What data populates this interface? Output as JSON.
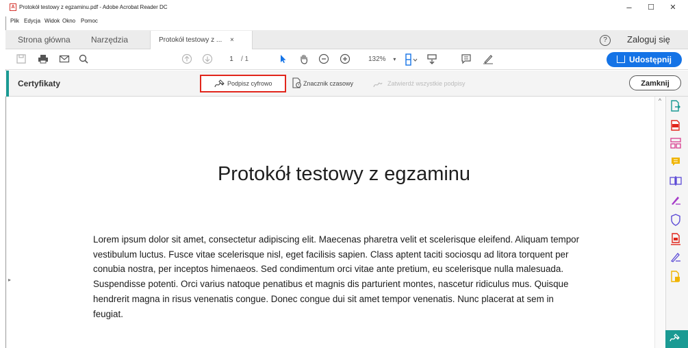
{
  "window": {
    "title": "Protokół testowy z egzaminu.pdf - Adobe Acrobat Reader DC",
    "controls": {
      "minimize": "–",
      "maximize": "☐",
      "close": "✕"
    }
  },
  "menu": [
    "Plik",
    "Edycja",
    "Widok",
    "Okno",
    "Pomoc"
  ],
  "tabs": {
    "home": "Strona główna",
    "tools": "Narzędzia",
    "document": "Protokół testowy z ...",
    "close": "×"
  },
  "header": {
    "help": "?",
    "login": "Zaloguj się"
  },
  "toolbar": {
    "page_current": "1",
    "page_total": "/ 1",
    "zoom": "132%",
    "share_label": "Udostępnij",
    "icons": [
      "save-icon",
      "print-icon",
      "email-icon",
      "search-icon",
      "prev-page-icon",
      "next-page-icon",
      "select-cursor-icon",
      "hand-icon",
      "zoom-out-icon",
      "zoom-in-icon",
      "fit-page-icon",
      "scroll-mode-icon",
      "comment-icon",
      "sign-pen-icon",
      "share-icon"
    ]
  },
  "certificates_bar": {
    "title": "Certyfikaty",
    "sign_digitally": "Podpisz cyfrowo",
    "timestamp": "Znacznik czasowy",
    "validate_all": "Zatwierdź wszystkie podpisy",
    "close": "Zamknij",
    "highlight_color": "#e1251b"
  },
  "document": {
    "title": "Protokół testowy z egzaminu",
    "body": "Lorem ipsum dolor sit amet, consectetur adipiscing elit. Maecenas pharetra velit et scelerisque eleifend. Aliquam tempor vestibulum luctus. Fusce vitae scelerisque nisl, eget facilisis sapien. Class aptent taciti sociosqu ad litora torquent per conubia nostra, per inceptos himenaeos. Sed condimentum orci vitae ante pretium, eu scelerisque nulla malesuada. Suspendisse potenti. Orci varius natoque penatibus et magnis dis parturient montes, nascetur ridiculus mus. Quisque hendrerit magna in risus venenatis congue. Donec congue dui sit amet tempor venenatis. Nunc placerat at sem in feugiat."
  },
  "right_panel_tools": [
    "export-pdf-icon",
    "create-pdf-icon",
    "organize-pages-icon",
    "comment-tool-icon",
    "combine-files-icon",
    "fill-sign-icon",
    "protect-icon",
    "send-for-review-icon",
    "request-signature-icon",
    "more-tools-icon",
    "certificates-icon"
  ],
  "colors": {
    "accent_blue": "#1473e6",
    "teal": "#1a9a93",
    "acrobat_red": "#d4332c"
  }
}
